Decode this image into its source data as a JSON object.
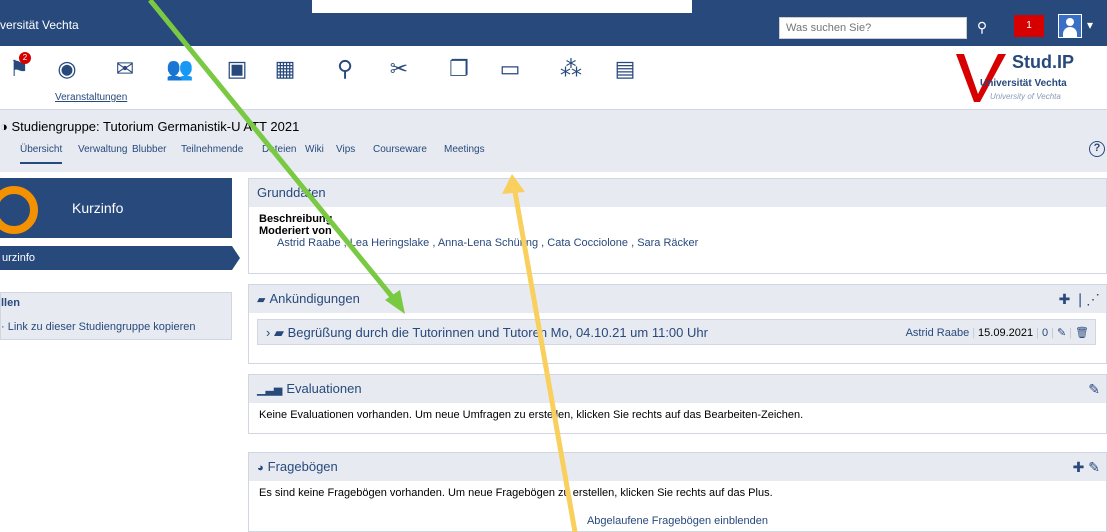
{
  "topbar": {
    "brand": "versität Vechta",
    "search_placeholder": "Was suchen Sie?",
    "notification_count": "1"
  },
  "nav": {
    "badge_count": "2",
    "active_label": "Veranstaltungen"
  },
  "logo": {
    "name": "Stud.IP",
    "university": "Universität Vechta",
    "subtitle": "University of Vechta"
  },
  "breadcrumb": "Studiengruppe: Tutorium Germanistik-",
  "breadcrumb_tail": "U ATT 2021",
  "tabs": [
    "Übersicht",
    "Verwaltung",
    "Blubber",
    "Teilnehmende",
    "Dateien",
    "Wiki",
    "Vips",
    "Courseware",
    "Meetings"
  ],
  "sidebar": {
    "header_title": "Kurzinfo",
    "active_item": "urzinfo",
    "section_title": "llen",
    "link": "Link zu dieser Studiengruppe kopieren"
  },
  "grunddaten": {
    "title": "Grunddaten",
    "beschreibung_label": "Beschreibung",
    "moderiert_label": "Moderiert von",
    "moderators": [
      "Astrid Raabe",
      "Lea Heringslake",
      "Anna-Lena Schüring",
      "Cata Cocciolone",
      "Sara Räcker"
    ]
  },
  "announcements": {
    "title": "Ankündigungen",
    "item_title": "Begrüßung durch die Tutorinnen und Tutoren Mo, 04.10.21 um 11:00 Uhr",
    "author": "Astrid Raabe",
    "date": "15.09.2021",
    "count": "0"
  },
  "evaluations": {
    "title": "Evaluationen",
    "text": "Keine Evaluationen vorhanden. Um neue Umfragen zu erstellen, klicken Sie rechts auf das Bearbeiten-Zeichen."
  },
  "questionnaires": {
    "title": "Fragebögen",
    "text": "Es sind keine Fragebögen vorhanden. Um neue Fragebögen zu erstellen, klicken Sie rechts auf das Plus.",
    "expired_link": "Abgelaufene Fragebögen einblenden"
  },
  "colors": {
    "primary": "#28497c",
    "accent_orange": "#f39100",
    "light_bg": "#e7ebf1",
    "arrow_green": "#7ac943",
    "arrow_yellow": "#f9cf5e"
  }
}
